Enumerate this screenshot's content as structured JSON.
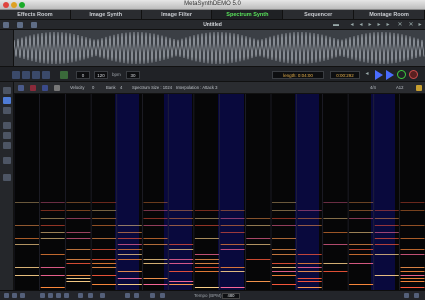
{
  "window": {
    "title": "MetaSynthDEMO 5.0"
  },
  "tabs": [
    {
      "label": "Effects Room"
    },
    {
      "label": "Image Synth"
    },
    {
      "label": "Image Filter"
    },
    {
      "label": "Spectrum Synth",
      "active": true
    },
    {
      "label": "Sequencer"
    },
    {
      "label": "Montage Room"
    }
  ],
  "document": {
    "title": "Untitled"
  },
  "transport": {
    "field_a": "0",
    "field_b": "120",
    "bpm_label": "bpm",
    "field_c": "30",
    "length_label": "length: 0:04:00",
    "time": "0:00:292"
  },
  "spectrum_toolbar": {
    "velocity_label": "Velocity",
    "velocity_value": "0",
    "bank_label": "Bank",
    "bank_value": "4",
    "size_label": "Spectrum Size : 1024",
    "interp_label": "Interpolation : Attack 3",
    "r_value1": "4/4",
    "r_value2": "A12"
  },
  "status": {
    "tempo_label": "Tempo (BPM)",
    "tempo_value": "480"
  },
  "colors": {
    "accent_green": "#58e15a",
    "play_blue": "#4a6cff"
  }
}
